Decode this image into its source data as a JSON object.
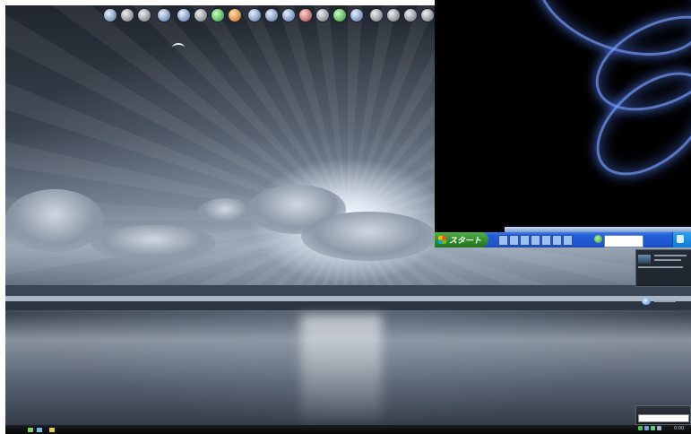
{
  "desktop": {
    "dock_icons": [
      "app-icon",
      "app-icon",
      "home-icon",
      "globe-icon",
      "globe-icon",
      "leaf-icon",
      "fire-icon",
      "app-icon",
      "app-icon",
      "app-icon",
      "app-icon",
      "app-icon",
      "app-icon",
      "app-icon",
      "user-icon",
      "user-icon",
      "user-icon",
      "trash-icon"
    ],
    "taskbar": {
      "clock": "0:00",
      "quick_launch": [
        "app-icon",
        "app-icon",
        "folder-icon"
      ]
    }
  },
  "xp_screen": {
    "start_label": "スタート",
    "search_placeholder": "",
    "colors": {
      "taskbar": "#245edb",
      "start": "#3c9a37",
      "tray": "#1a8ae6"
    }
  }
}
